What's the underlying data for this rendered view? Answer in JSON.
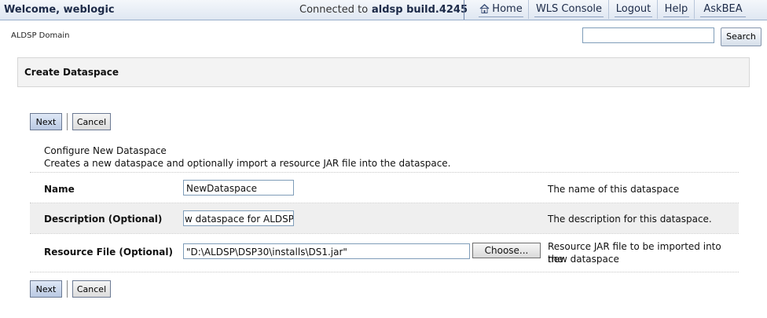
{
  "header": {
    "welcome": "Welcome, weblogic",
    "connected_label": "Connected to :",
    "connected_name": "aldsp  build.4245",
    "nav": [
      "Home",
      "WLS Console",
      "Logout",
      "Help",
      "AskBEA"
    ]
  },
  "breadcrumb": "ALDSP Domain",
  "search": {
    "value": "",
    "button": "Search"
  },
  "page_title": "Create Dataspace",
  "buttons": {
    "next": "Next",
    "cancel": "Cancel"
  },
  "intro": {
    "title": "Configure New Dataspace",
    "description": "Creates a new dataspace and optionally import a resource JAR file into the dataspace."
  },
  "form": {
    "name": {
      "label": "Name",
      "value": "NewDataspace",
      "help": "The name of this dataspace"
    },
    "description": {
      "label": "Description (Optional)",
      "value": "w dataspace for ALDSP",
      "help": "The description for this dataspace."
    },
    "resource_file": {
      "label": "Resource File (Optional)",
      "value": "\"D:\\ALDSP\\DSP30\\installs\\DS1.jar\"",
      "choose": "Choose...",
      "help_line1": "Resource JAR file to be imported into the",
      "help_line2": "new dataspace"
    }
  }
}
